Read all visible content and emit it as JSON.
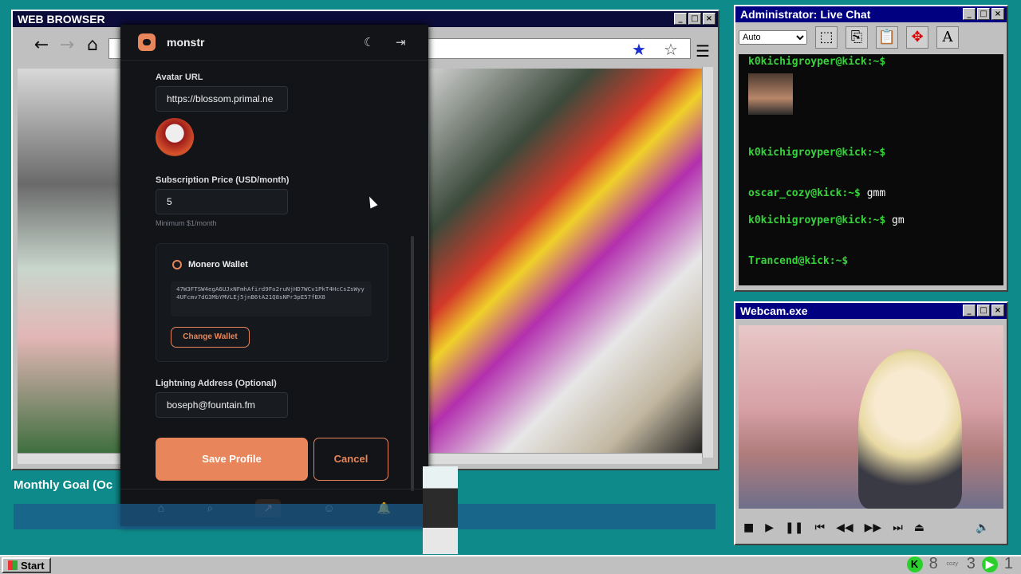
{
  "browser": {
    "title": "WEB BROWSER"
  },
  "chat": {
    "title": "Administrator: Live Chat",
    "zoom_option": "Auto",
    "lines": [
      {
        "prompt": "k0kichigroyper@kick:~$",
        "msg": ""
      },
      {
        "prompt": "k0kichigroyper@kick:~$",
        "msg": ""
      },
      {
        "prompt": "oscar_cozy@kick:~$",
        "msg": "gmm"
      },
      {
        "prompt": "k0kichigroyper@kick:~$",
        "msg": "gm"
      },
      {
        "prompt": "Trancend@kick:~$",
        "msg": ""
      }
    ]
  },
  "webcam": {
    "title": "Webcam.exe"
  },
  "monstr": {
    "app_name": "monstr",
    "avatar_label": "Avatar URL",
    "avatar_url": "https://blossom.primal.ne",
    "price_label": "Subscription Price (USD/month)",
    "price_value": "5",
    "price_hint": "Minimum $1/month",
    "wallet_title": "Monero Wallet",
    "wallet_address": "47W3FTSW4egA6UJxNFmhAfird9Fo2ruNjHD7WCv1PkT4HcCsZsWyy4UFcmv7dG3MbYMVLEj5jnB6tA21Q8sNPr3pE57fBX8",
    "change_wallet": "Change Wallet",
    "lightning_label": "Lightning Address (Optional)",
    "lightning_value": "boseph@fountain.fm",
    "save_label": "Save Profile",
    "cancel_label": "Cancel"
  },
  "overlay": {
    "goal_label": "Monthly Goal (Oc"
  },
  "taskbar": {
    "start_label": "Start",
    "k_count": "8",
    "play_count": "3",
    "last_count": "1"
  },
  "colors": {
    "accent": "#e8855a",
    "desktop": "#0f8a8a",
    "titlebar": "#000080"
  }
}
